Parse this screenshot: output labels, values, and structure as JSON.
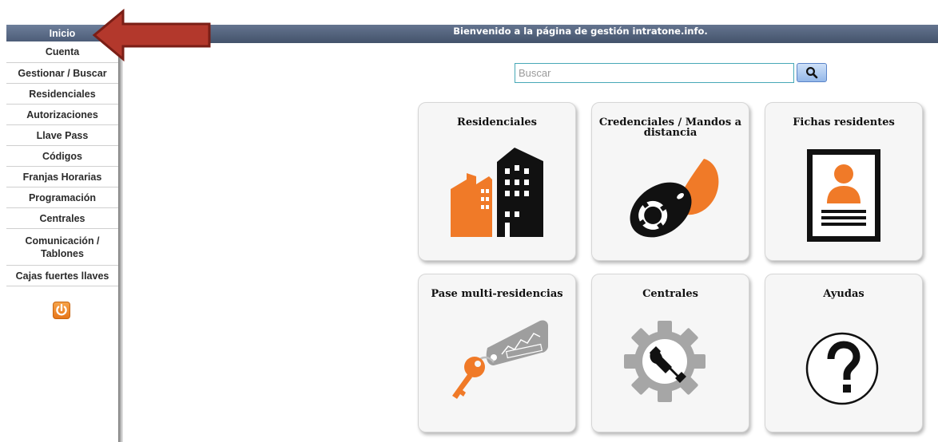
{
  "sidebar": {
    "items": [
      {
        "label": "Inicio",
        "active": true
      },
      {
        "label": "Cuenta"
      },
      {
        "label": "Gestionar / Buscar"
      },
      {
        "label": "Residenciales"
      },
      {
        "label": "Autorizaciones"
      },
      {
        "label": "Llave Pass"
      },
      {
        "label": "Códigos"
      },
      {
        "label": "Franjas Horarias"
      },
      {
        "label": "Programación"
      },
      {
        "label": "Centrales"
      },
      {
        "label": "Comunicación / Tablones"
      },
      {
        "label": "Cajas fuertes llaves"
      }
    ],
    "power_icon": "power-icon"
  },
  "header": {
    "welcome": "Bienvenido a la página de gestión intratone.info."
  },
  "search": {
    "placeholder": "Buscar",
    "value": "",
    "button_icon": "search-icon"
  },
  "cards": [
    {
      "title": "Residenciales",
      "icon": "buildings-icon"
    },
    {
      "title": "Credenciales / Mandos a distancia",
      "icon": "key-fob-icon"
    },
    {
      "title": "Fichas residentes",
      "icon": "resident-card-icon"
    },
    {
      "title": "Pase multi-residencias",
      "icon": "key-tag-icon"
    },
    {
      "title": "Centrales",
      "icon": "gear-wrench-icon"
    },
    {
      "title": "Ayudas",
      "icon": "question-icon"
    }
  ],
  "colors": {
    "accent_orange": "#f07a28",
    "header_blue": "#4f5f7a",
    "annotation_red": "#b3382c"
  }
}
